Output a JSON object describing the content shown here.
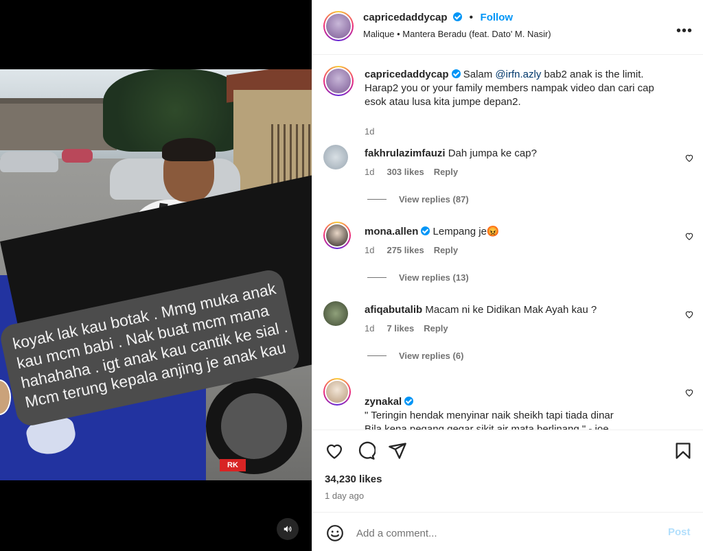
{
  "media": {
    "caption_overlay": "koyak lak kau botak . Mmg muka anak kau mcm babi . Nak buat mcm mana hahahaha . igt anak kau cantik ke sial . Mcm terung kepala anjing je anak kau",
    "plate_text": "RK",
    "sound_icon": "speaker-icon"
  },
  "header": {
    "username": "capricedaddycap",
    "separator": "•",
    "follow_label": "Follow",
    "music": "Malique • Mantera Beradu (feat. Dato' M. Nasir)",
    "more_label": "•••"
  },
  "caption": {
    "username": "capricedaddycap",
    "text_before": "Salam ",
    "mention": "@irfn.azly",
    "text_after": " bab2 anak is the limit. Harap2 you or your family members nampak video dan cari cap esok atau lusa kita jumpe depan2.",
    "age": "1d"
  },
  "comments": [
    {
      "username": "fakhrulazimfauzi",
      "verified": false,
      "text": "Dah jumpa ke cap?",
      "age": "1d",
      "likes": "303 likes",
      "reply": "Reply",
      "view_replies": "View replies (87)"
    },
    {
      "username": "mona.allen",
      "verified": true,
      "text": "Lempang je😡",
      "age": "1d",
      "likes": "275 likes",
      "reply": "Reply",
      "view_replies": "View replies (13)"
    },
    {
      "username": "afiqabutalib",
      "verified": false,
      "text": "Macam ni ke Didikan Mak Ayah kau ?",
      "age": "1d",
      "likes": "7 likes",
      "reply": "Reply",
      "view_replies": "View replies (6)"
    },
    {
      "username": "zynakal",
      "verified": true,
      "text": "\" Teringin hendak menyinar naik sheikh tapi tiada dinar\nBila kena pegang gegar sikit air mata berlinang \" - joe"
    }
  ],
  "footer": {
    "likes": "34,230 likes",
    "time": "1 day ago",
    "comment_placeholder": "Add a comment...",
    "post_label": "Post"
  },
  "colors": {
    "accent": "#0095f6",
    "text": "#262626",
    "muted": "#737373",
    "post_disabled": "#b2dffc"
  }
}
